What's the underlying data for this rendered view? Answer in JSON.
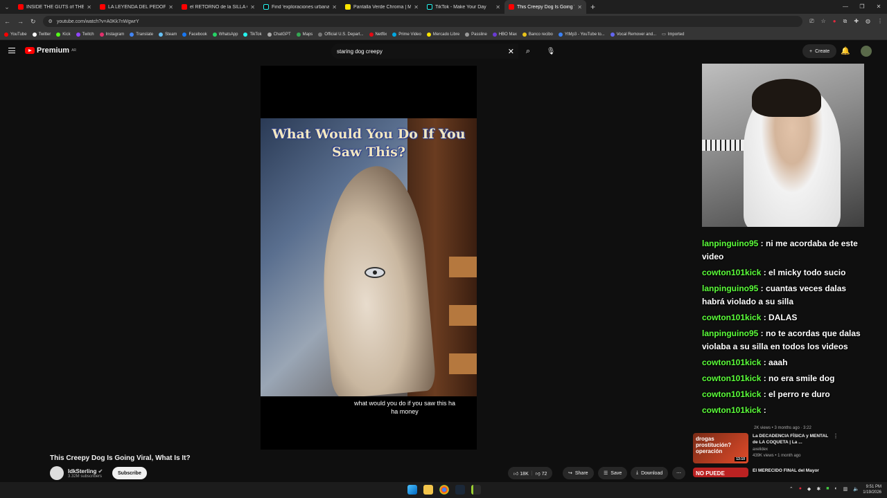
{
  "browser": {
    "tabs": [
      {
        "label": "INSIDE THE GUTS of THE CRAZ",
        "icon": "youtube-icon"
      },
      {
        "label": "LA LEYENDA DEL PEDOFILO DE",
        "icon": "youtube-icon"
      },
      {
        "label": "el RETORNO de la SILLA GAME",
        "icon": "youtube-icon"
      },
      {
        "label": "Find 'exploraciones urbanas' o",
        "icon": "tiktok-icon"
      },
      {
        "label": "Pantalla Verde Chroma | Merca",
        "icon": "mercadolibre-icon"
      },
      {
        "label": "TikTok - Make Your Day",
        "icon": "tiktok-icon"
      },
      {
        "label": "This Creepy Dog Is Going Viral",
        "icon": "youtube-icon"
      }
    ],
    "url": "youtube.com/watch?v=A0Kk7nWgwrY",
    "bookmarks": [
      "YouTube",
      "Twitter",
      "Kick",
      "Twitch",
      "Instagram",
      "Translate",
      "Steam",
      "Facebook",
      "WhatsApp",
      "TikTok",
      "ChatGPT",
      "Maps",
      "Official U.S. Depart...",
      "Netflix",
      "Prime Video",
      "Mercado Libre",
      "Passline",
      "HBO Max",
      "Banco recibo",
      "YtMp3 - YouTube to...",
      "Vocal Remover and...",
      "Imported"
    ]
  },
  "youtube": {
    "logo_text": "Premium",
    "logo_region": "AR",
    "search_query": "staring dog creepy",
    "create_label": "Create"
  },
  "video": {
    "overlay_text": "What Would You Do If You Saw This?",
    "subtitle": "what would you do if you saw this ha ha money",
    "title": "This Creepy Dog Is Going Viral, What Is It?",
    "channel": "IdkSterling",
    "subscribers": "3.32M subscribers",
    "subscribe_label": "Subscribe",
    "likes": "18K",
    "comments": "72",
    "share_label": "Share",
    "save_label": "Save",
    "download_label": "Download"
  },
  "chat": [
    {
      "user": "lanpinguino95",
      "text": "ni me acordaba de este video"
    },
    {
      "user": "cowton101kick",
      "text": "el micky todo sucio"
    },
    {
      "user": "lanpinguino95",
      "text": "cuantas veces dalas habrá violado a su silla"
    },
    {
      "user": "cowton101kick",
      "text": "DALAS"
    },
    {
      "user": "lanpinguino95",
      "text": "no te acordas que dalas violaba a su silla en todos los videos"
    },
    {
      "user": "cowton101kick",
      "text": "aaah"
    },
    {
      "user": "cowton101kick",
      "text": "no era smile dog"
    },
    {
      "user": "cowton101kick",
      "text": "el perro re duro"
    },
    {
      "user": "cowton101kick",
      "text": ""
    }
  ],
  "recommendations": [
    {
      "thumb_text": "drogas prostitución? operación",
      "title": "La DECADENCIA FÍSICA y MENTAL de LA COQUETA | La ...",
      "channel": "axelidex",
      "meta": "439K views • 1 month ago",
      "duration": "13:10"
    },
    {
      "thumb_text": "NO PUEDE",
      "title": "El MERECIDO FINAL del Mayor",
      "channel": "",
      "meta": "",
      "duration": ""
    }
  ],
  "rec_prev_meta": "2K views • 3 months ago",
  "rec_prev_duration": "3:22",
  "clock": {
    "time": "9:51 PM",
    "date": "1/19/2026"
  }
}
